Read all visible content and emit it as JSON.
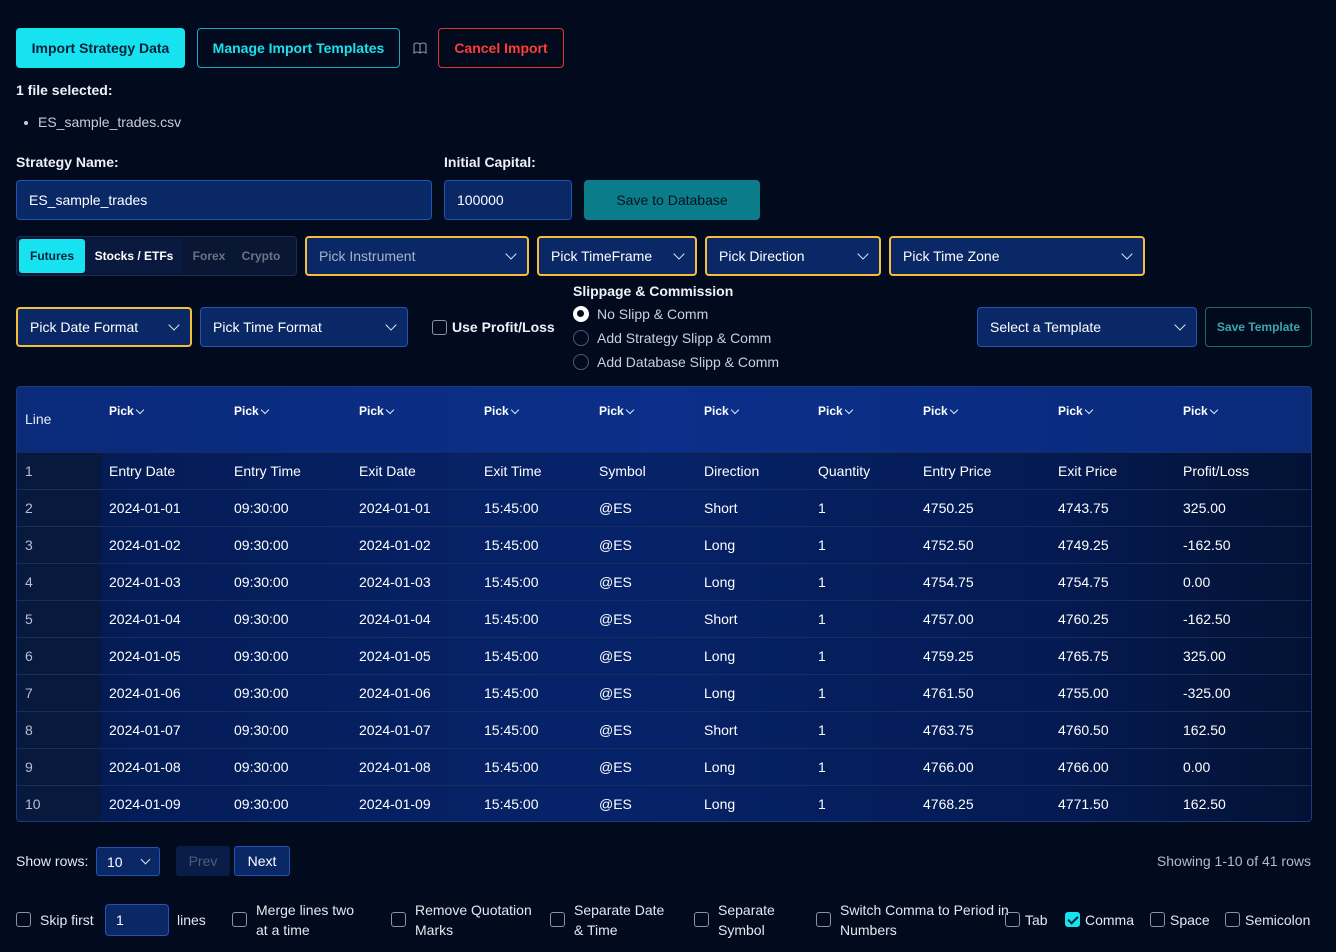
{
  "toolbar": {
    "import_label": "Import Strategy Data",
    "manage_label": "Manage Import Templates",
    "book_icon": "book-icon",
    "cancel_label": "Cancel Import"
  },
  "files": {
    "selected_label": "1 file selected:",
    "items": [
      "ES_sample_trades.csv"
    ]
  },
  "form": {
    "strategy_label": "Strategy Name:",
    "strategy_value": "ES_sample_trades",
    "capital_label": "Initial Capital:",
    "capital_value": "100000",
    "save_db_label": "Save to Database"
  },
  "asset_tabs": [
    "Futures",
    "Stocks / ETFs",
    "Forex",
    "Crypto"
  ],
  "selects": {
    "instrument": "Pick Instrument",
    "timeframe": "Pick TimeFrame",
    "direction": "Pick Direction",
    "timezone": "Pick Time Zone",
    "date_format": "Pick Date Format",
    "time_format": "Pick Time Format",
    "template": "Select a Template"
  },
  "use_profit_loss": "Use Profit/Loss",
  "slippage": {
    "title": "Slippage & Commission",
    "options": [
      "No Slipp & Comm",
      "Add Strategy Slipp & Comm",
      "Add Database Slipp & Comm"
    ],
    "selected_index": 0
  },
  "save_template_label": "Save Template",
  "table": {
    "line_header": "Line",
    "pick_label": "Pick",
    "rows": [
      {
        "line": "1",
        "cells": [
          "Entry Date",
          "Entry Time",
          "Exit Date",
          "Exit Time",
          "Symbol",
          "Direction",
          "Quantity",
          "Entry Price",
          "Exit Price",
          "Profit/Loss"
        ]
      },
      {
        "line": "2",
        "cells": [
          "2024-01-01",
          "09:30:00",
          "2024-01-01",
          "15:45:00",
          "@ES",
          "Short",
          "1",
          "4750.25",
          "4743.75",
          "325.00"
        ]
      },
      {
        "line": "3",
        "cells": [
          "2024-01-02",
          "09:30:00",
          "2024-01-02",
          "15:45:00",
          "@ES",
          "Long",
          "1",
          "4752.50",
          "4749.25",
          "-162.50"
        ]
      },
      {
        "line": "4",
        "cells": [
          "2024-01-03",
          "09:30:00",
          "2024-01-03",
          "15:45:00",
          "@ES",
          "Long",
          "1",
          "4754.75",
          "4754.75",
          "0.00"
        ]
      },
      {
        "line": "5",
        "cells": [
          "2024-01-04",
          "09:30:00",
          "2024-01-04",
          "15:45:00",
          "@ES",
          "Short",
          "1",
          "4757.00",
          "4760.25",
          "-162.50"
        ]
      },
      {
        "line": "6",
        "cells": [
          "2024-01-05",
          "09:30:00",
          "2024-01-05",
          "15:45:00",
          "@ES",
          "Long",
          "1",
          "4759.25",
          "4765.75",
          "325.00"
        ]
      },
      {
        "line": "7",
        "cells": [
          "2024-01-06",
          "09:30:00",
          "2024-01-06",
          "15:45:00",
          "@ES",
          "Long",
          "1",
          "4761.50",
          "4755.00",
          "-325.00"
        ]
      },
      {
        "line": "8",
        "cells": [
          "2024-01-07",
          "09:30:00",
          "2024-01-07",
          "15:45:00",
          "@ES",
          "Short",
          "1",
          "4763.75",
          "4760.50",
          "162.50"
        ]
      },
      {
        "line": "9",
        "cells": [
          "2024-01-08",
          "09:30:00",
          "2024-01-08",
          "15:45:00",
          "@ES",
          "Long",
          "1",
          "4766.00",
          "4766.00",
          "0.00"
        ]
      },
      {
        "line": "10",
        "cells": [
          "2024-01-09",
          "09:30:00",
          "2024-01-09",
          "15:45:00",
          "@ES",
          "Long",
          "1",
          "4768.25",
          "4771.50",
          "162.50"
        ]
      }
    ]
  },
  "pagination": {
    "show_rows_label": "Show rows:",
    "rows_value": "10",
    "prev_label": "Prev",
    "next_label": "Next",
    "showing_text": "Showing 1-10 of 41 rows"
  },
  "options": {
    "skip_first_label": "Skip first",
    "skip_first_value": "1",
    "lines_label": "lines",
    "merge_label": "Merge lines two at a time",
    "remove_quotes_label": "Remove Quotation Marks",
    "separate_dt_label": "Separate Date & Time",
    "separate_symbol_label": "Separate Symbol",
    "switch_comma_label": "Switch Comma to Period in Numbers",
    "delimiters": [
      {
        "label": "Tab",
        "checked": false
      },
      {
        "label": "Comma",
        "checked": true
      },
      {
        "label": "Space",
        "checked": false
      },
      {
        "label": "Semicolon",
        "checked": false
      }
    ]
  },
  "colors": {
    "accent": "#17e3f0",
    "highlight_border": "#f3bf3a",
    "danger": "#e2322d",
    "background": "#020a1e"
  }
}
